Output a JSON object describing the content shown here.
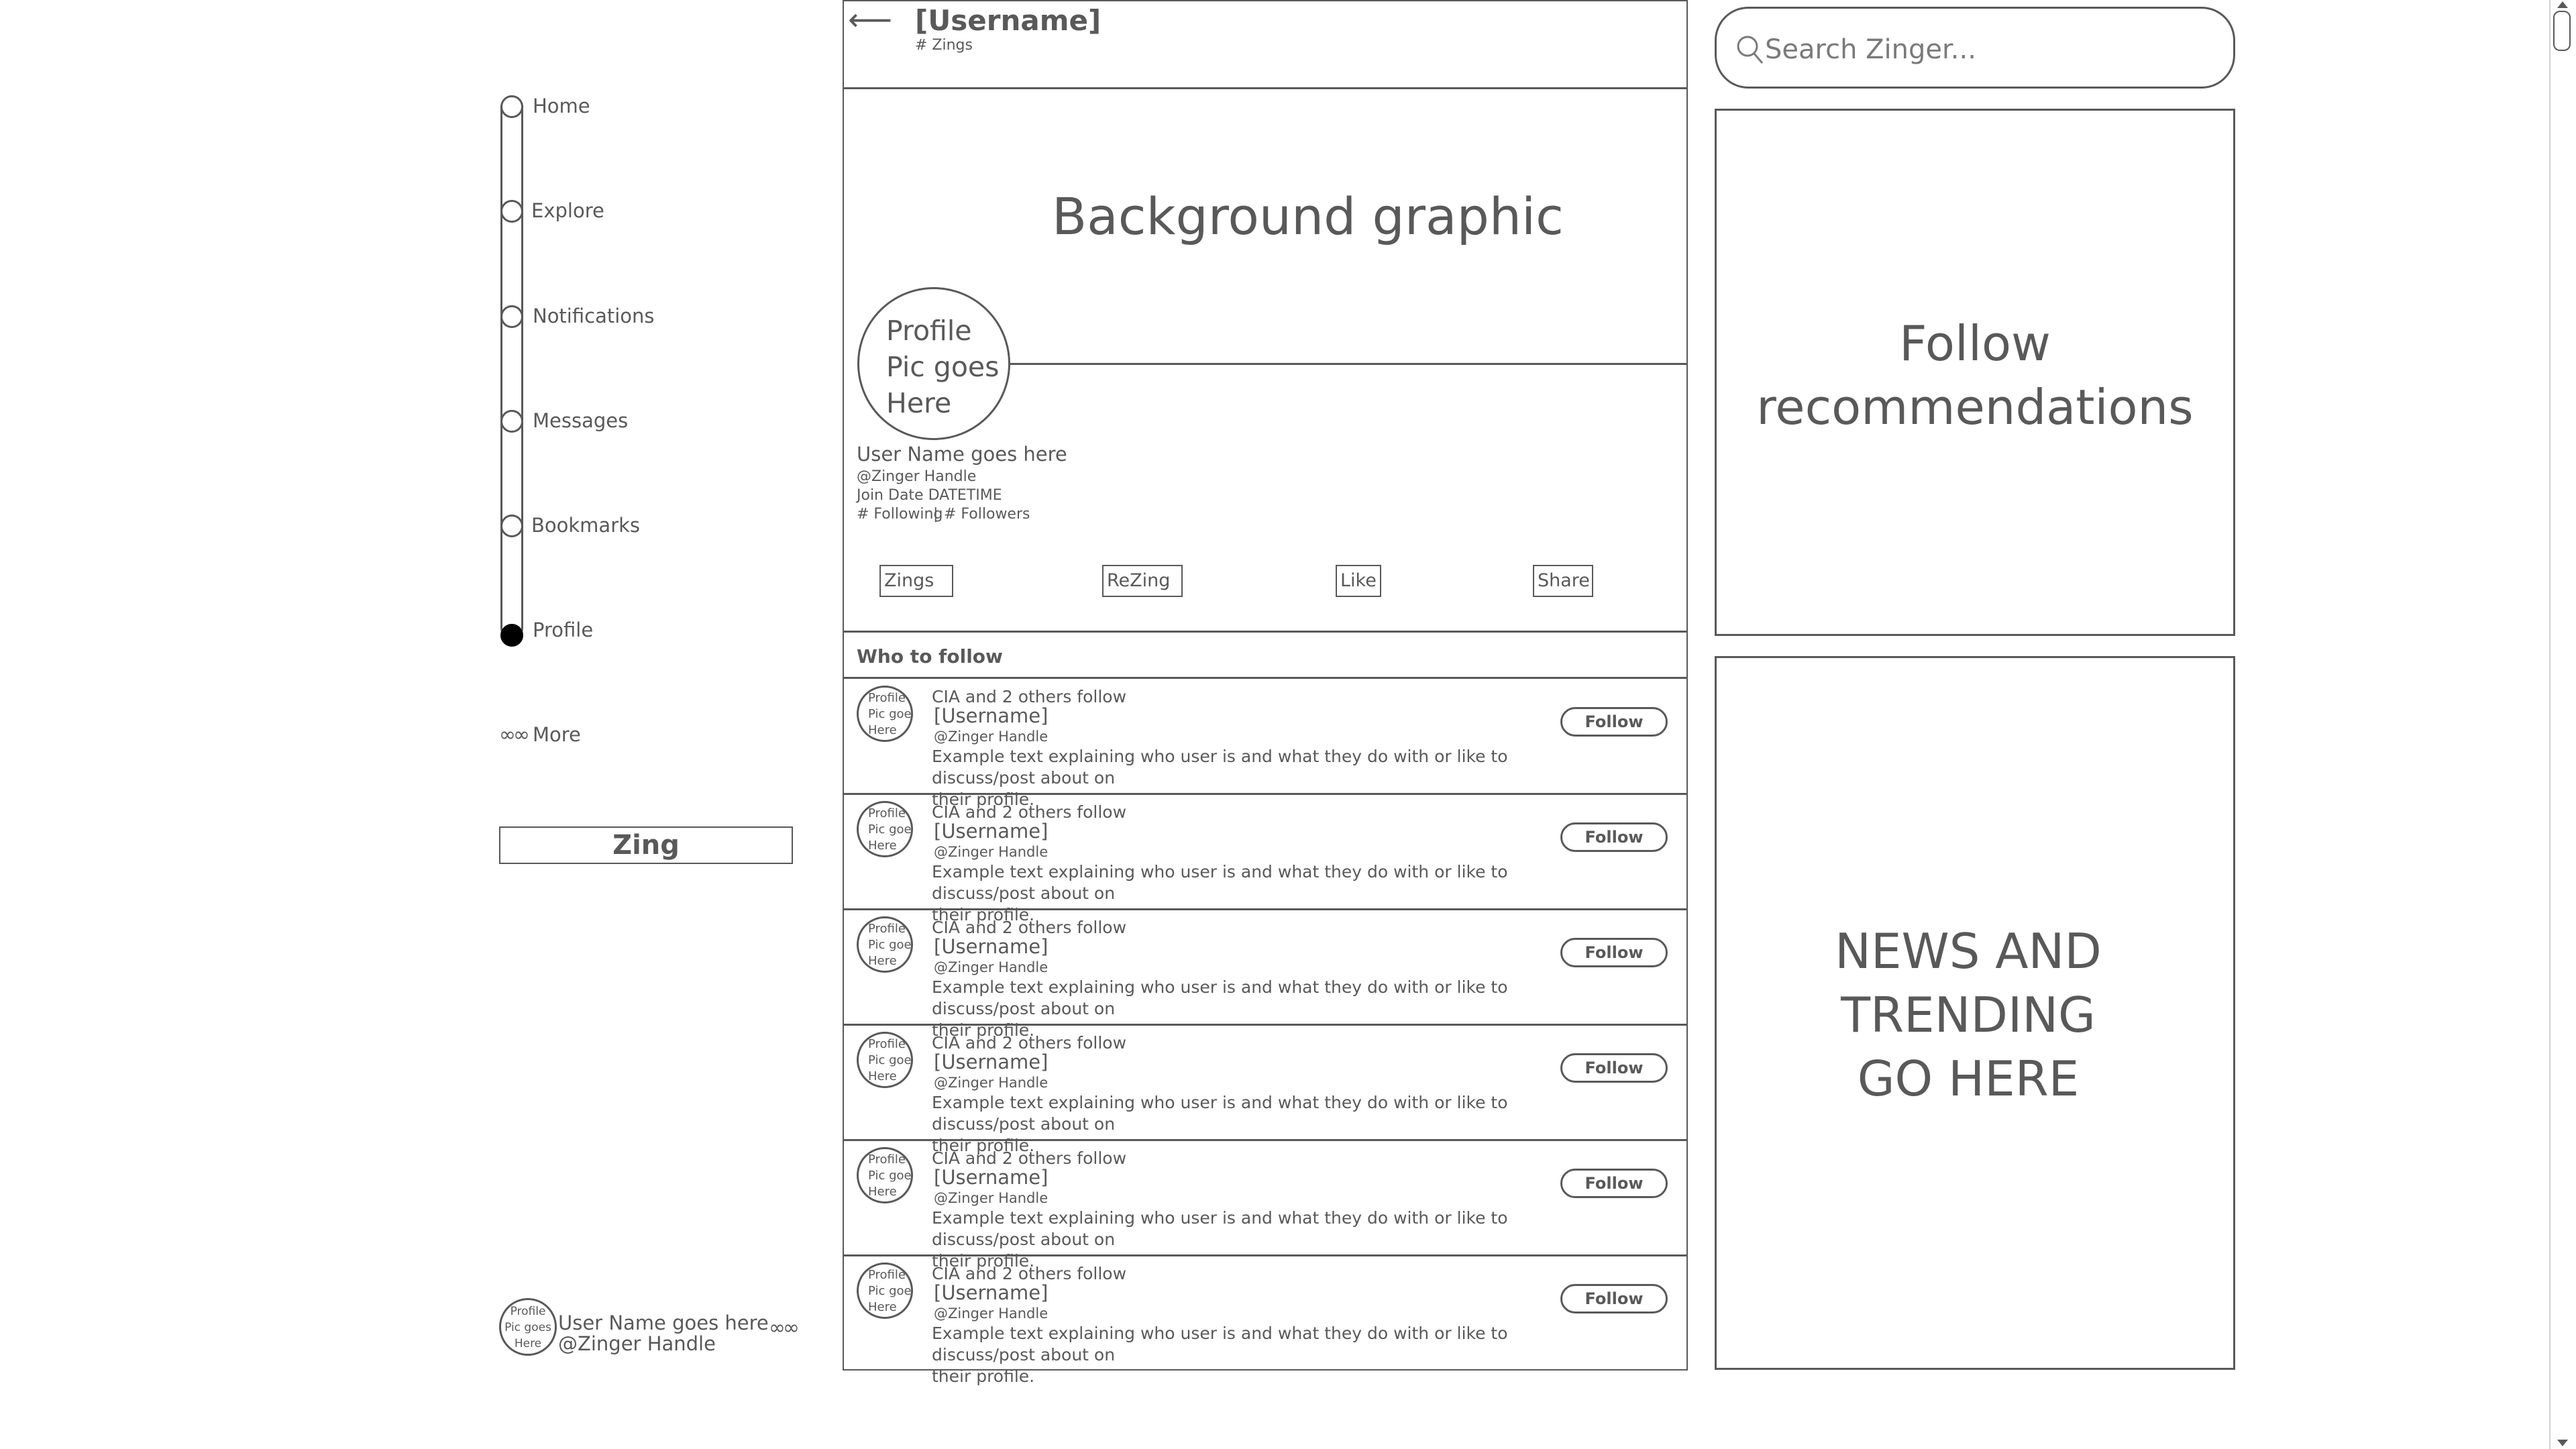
{
  "nav": {
    "items": [
      {
        "label": "Home"
      },
      {
        "label": "Explore"
      },
      {
        "label": "Notifications"
      },
      {
        "label": "Messages"
      },
      {
        "label": "Bookmarks"
      },
      {
        "label": "Profile"
      }
    ],
    "more_label": "More",
    "more_icon": "∞∞",
    "zing_label": "Zing"
  },
  "footer_user": {
    "pic_text": [
      "Profile",
      "Pic goes",
      "Here"
    ],
    "name": "User Name goes here",
    "handle": "@Zinger Handle",
    "more_icon": "∞∞"
  },
  "header": {
    "back_icon": "⟵",
    "title": "[Username]",
    "subtitle": "# Zings"
  },
  "profile": {
    "background_text": "Background graphic",
    "pic_text": [
      "Profile",
      "Pic goes",
      "Here"
    ],
    "name": "User Name goes here",
    "handle": "@Zinger Handle",
    "join_date": "Join Date DATETIME",
    "following": "# Following",
    "separator": "|",
    "followers": "# Followers",
    "tabs": [
      "Zings",
      "ReZing",
      "Like",
      "Share"
    ]
  },
  "who_to_follow": {
    "title": "Who to follow",
    "rows": [
      {
        "pic": [
          "Profile",
          "Pic goes",
          "Here"
        ],
        "context": "CIA and 2 others follow",
        "username": "[Username]",
        "handle": "@Zinger Handle",
        "bio_line1": "Example text explaining who user is and what they do with or like to discuss/post about on",
        "bio_line2": "their profile.",
        "button": "Follow"
      },
      {
        "pic": [
          "Profile",
          "Pic goes",
          "Here"
        ],
        "context": "CIA and 2 others follow",
        "username": "[Username]",
        "handle": "@Zinger Handle",
        "bio_line1": "Example text explaining who user is and what they do with or like to discuss/post about on",
        "bio_line2": "their profile.",
        "button": "Follow"
      },
      {
        "pic": [
          "Profile",
          "Pic goes",
          "Here"
        ],
        "context": "CIA and 2 others follow",
        "username": "[Username]",
        "handle": "@Zinger Handle",
        "bio_line1": "Example text explaining who user is and what they do with or like to discuss/post about on",
        "bio_line2": "their profile.",
        "button": "Follow"
      },
      {
        "pic": [
          "Profile",
          "Pic goes",
          "Here"
        ],
        "context": "CIA and 2 others follow",
        "username": "[Username]",
        "handle": "@Zinger Handle",
        "bio_line1": "Example text explaining who user is and what they do with or like to discuss/post about on",
        "bio_line2": "their profile.",
        "button": "Follow"
      },
      {
        "pic": [
          "Profile",
          "Pic goes",
          "Here"
        ],
        "context": "CIA and 2 others follow",
        "username": "[Username]",
        "handle": "@Zinger Handle",
        "bio_line1": "Example text explaining who user is and what they do with or like to discuss/post about on",
        "bio_line2": "their profile.",
        "button": "Follow"
      },
      {
        "pic": [
          "Profile",
          "Pic goes",
          "Here"
        ],
        "context": "CIA and 2 others follow",
        "username": "[Username]",
        "handle": "@Zinger Handle",
        "bio_line1": "Example text explaining who user is and what they do with or like to discuss/post about on",
        "bio_line2": "their profile.",
        "button": "Follow"
      }
    ]
  },
  "right": {
    "search_placeholder": "Search Zinger...",
    "follow_recs": [
      "Follow",
      "recommendations"
    ],
    "news": [
      "NEWS AND",
      "TRENDING",
      "GO HERE"
    ]
  }
}
